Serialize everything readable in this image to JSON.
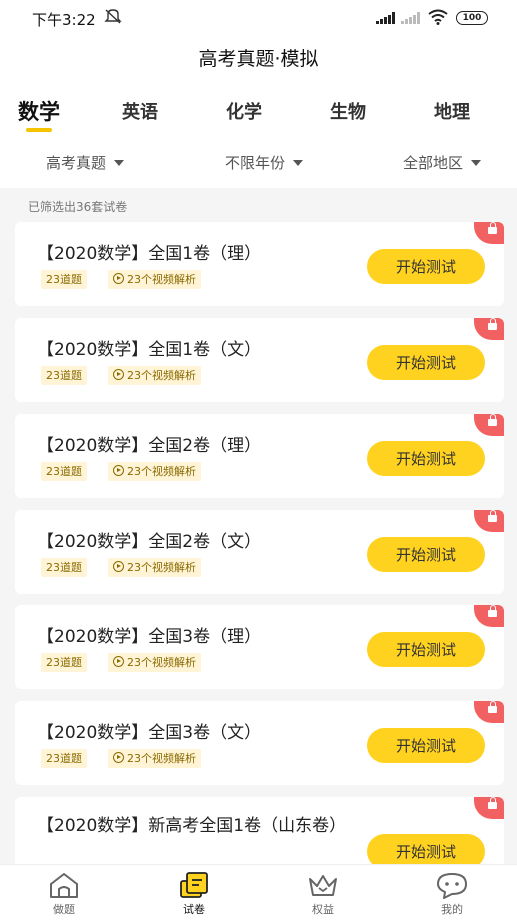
{
  "status_bar": {
    "time": "下午3:22",
    "battery": "100"
  },
  "page_title": "高考真题·模拟",
  "subject_tabs": [
    "数学",
    "英语",
    "化学",
    "生物",
    "地理"
  ],
  "filters": [
    "高考真题",
    "不限年份",
    "全部地区"
  ],
  "result_count": "已筛选出36套试卷",
  "papers": [
    {
      "title": "【2020数学】全国1卷（理）",
      "questions": "23道题",
      "videos": "23个视频解析",
      "action": "开始测试"
    },
    {
      "title": "【2020数学】全国1卷（文）",
      "questions": "23道题",
      "videos": "23个视频解析",
      "action": "开始测试"
    },
    {
      "title": "【2020数学】全国2卷（理）",
      "questions": "23道题",
      "videos": "23个视频解析",
      "action": "开始测试"
    },
    {
      "title": "【2020数学】全国2卷（文）",
      "questions": "23道题",
      "videos": "23个视频解析",
      "action": "开始测试"
    },
    {
      "title": "【2020数学】全国3卷（理）",
      "questions": "23道题",
      "videos": "23个视频解析",
      "action": "开始测试"
    },
    {
      "title": "【2020数学】全国3卷（文）",
      "questions": "23道题",
      "videos": "23个视频解析",
      "action": "开始测试"
    },
    {
      "title": "【2020数学】新高考全国1卷（山东卷）",
      "questions": "",
      "videos": "",
      "action": "开始测试"
    }
  ],
  "bottom_nav": [
    "做题",
    "试卷",
    "权益",
    "我的"
  ],
  "colors": {
    "accent_yellow": "#ffd21f",
    "lock_red": "#f26161",
    "tag_bg": "#fff4d6"
  }
}
